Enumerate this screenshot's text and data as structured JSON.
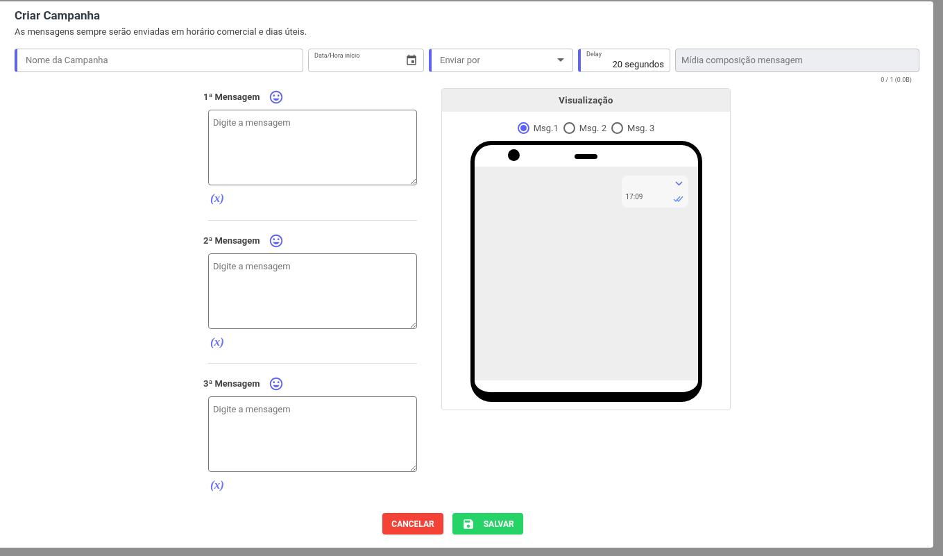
{
  "dialog": {
    "title": "Criar Campanha",
    "subtitle": "As mensagens sempre serão enviadas em horário comercial e dias úteis."
  },
  "fields": [
    {
      "kind": "text",
      "placeholder": "Nome da Campanha",
      "required": true
    },
    {
      "kind": "date",
      "label": "Data/Hora início",
      "required": false
    },
    {
      "kind": "select",
      "placeholder": "Enviar por",
      "required": true
    },
    {
      "kind": "delay",
      "label": "Delay",
      "value": "20 segundos",
      "required": true
    },
    {
      "kind": "media",
      "placeholder": "Mídia composição mensagem",
      "required": false
    }
  ],
  "media_counter": "0 / 1 (0.0B)",
  "messages": [
    {
      "label": "1ª Mensagem",
      "placeholder": "Digite a mensagem",
      "variable": "(x)"
    },
    {
      "label": "2ª Mensagem",
      "placeholder": "Digite a mensagem",
      "variable": "(x)"
    },
    {
      "label": "3ª Mensagem",
      "placeholder": "Digite a mensagem",
      "variable": "(x)"
    }
  ],
  "preview": {
    "title": "Visualização",
    "options": [
      {
        "label": "Msg.1",
        "selected": true
      },
      {
        "label": "Msg. 2",
        "selected": false
      },
      {
        "label": "Msg. 3",
        "selected": false
      }
    ],
    "bubble_time": "17:09"
  },
  "buttons": [
    {
      "kind": "cancel",
      "label": "CANCELAR"
    },
    {
      "kind": "save",
      "label": "SALVAR"
    }
  ]
}
